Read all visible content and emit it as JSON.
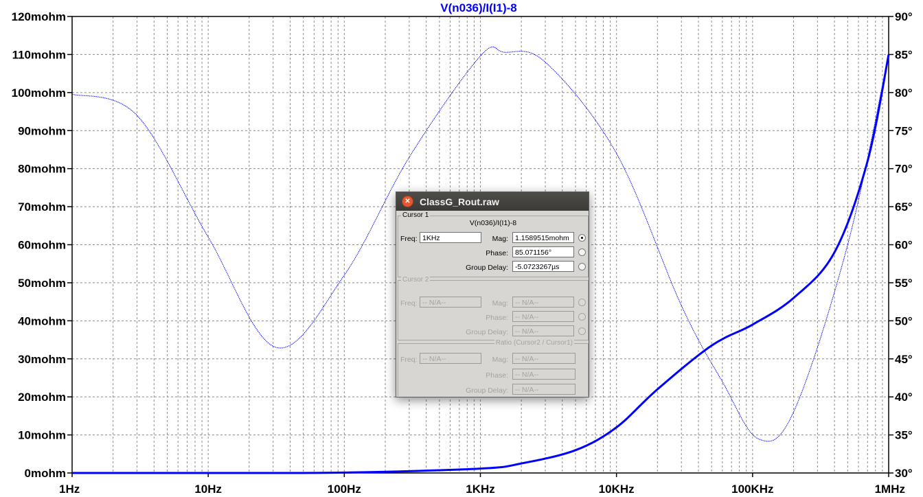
{
  "chart_data": {
    "type": "line",
    "title": "V(n036)/I(I1)-8",
    "x_axis": {
      "scale": "log",
      "range": [
        1,
        1000000
      ],
      "tick_labels": [
        "1Hz",
        "10Hz",
        "100Hz",
        "1KHz",
        "10KHz",
        "100KHz",
        "1MHz"
      ]
    },
    "y_left": {
      "unit": "mohm",
      "range": [
        0,
        120
      ],
      "tick_labels": [
        "0mohm",
        "10mohm",
        "20mohm",
        "30mohm",
        "40mohm",
        "50mohm",
        "60mohm",
        "70mohm",
        "80mohm",
        "90mohm",
        "100mohm",
        "110mohm",
        "120mohm"
      ]
    },
    "y_right": {
      "unit": "degrees",
      "range": [
        30,
        90
      ],
      "tick_labels": [
        "30°",
        "35°",
        "40°",
        "45°",
        "50°",
        "55°",
        "60°",
        "65°",
        "70°",
        "75°",
        "80°",
        "85°",
        "90°"
      ]
    },
    "grid": true,
    "series": [
      {
        "style": "solid-thick",
        "axis": "left",
        "x": [
          1,
          10,
          100,
          1000,
          2000,
          5000,
          10000,
          20000,
          50000,
          100000,
          200000,
          400000,
          700000,
          1000000
        ],
        "y": [
          0,
          0,
          0.1,
          1.16,
          2.5,
          6,
          12,
          22,
          33.5,
          39,
          46,
          58,
          82,
          110
        ]
      },
      {
        "style": "dotted-thin",
        "axis": "right",
        "x": [
          1,
          3,
          10,
          31.6,
          100,
          300,
          1000,
          1500,
          3000,
          10000,
          30000,
          60000,
          110000,
          200000,
          500000,
          1000000
        ],
        "y": [
          79.8,
          77,
          61,
          46.5,
          56,
          71.5,
          84.8,
          85.3,
          84,
          72,
          52,
          42,
          34.5,
          38,
          60,
          85
        ]
      }
    ]
  },
  "dialog": {
    "title": "ClassG_Rout.raw",
    "cursor1": {
      "group_title": "Cursor 1",
      "trace": "V(n036)/I(I1)-8",
      "freq_label": "Freq:",
      "freq_value": "1KHz",
      "mag_label": "Mag:",
      "mag_value": "1.1589515mohm",
      "phase_label": "Phase:",
      "phase_value": "85.071156°",
      "gd_label": "Group Delay:",
      "gd_value": "-5.0723267µs"
    },
    "cursor2": {
      "group_title": "Cursor 2",
      "freq_label": "Freq:",
      "freq_value": "-- N/A--",
      "mag_label": "Mag:",
      "mag_value": "-- N/A--",
      "phase_label": "Phase:",
      "phase_value": "-- N/A--",
      "gd_label": "Group Delay:",
      "gd_value": "-- N/A--"
    },
    "ratio": {
      "group_title": "Ratio (Cursor2 / Cursor1)",
      "freq_label": "Freq:",
      "freq_value": "-- N/A--",
      "mag_label": "Mag:",
      "mag_value": "-- N/A--",
      "phase_label": "Phase:",
      "phase_value": "-- N/A--",
      "gd_label": "Group Delay:",
      "gd_value": "-- N/A--"
    }
  }
}
